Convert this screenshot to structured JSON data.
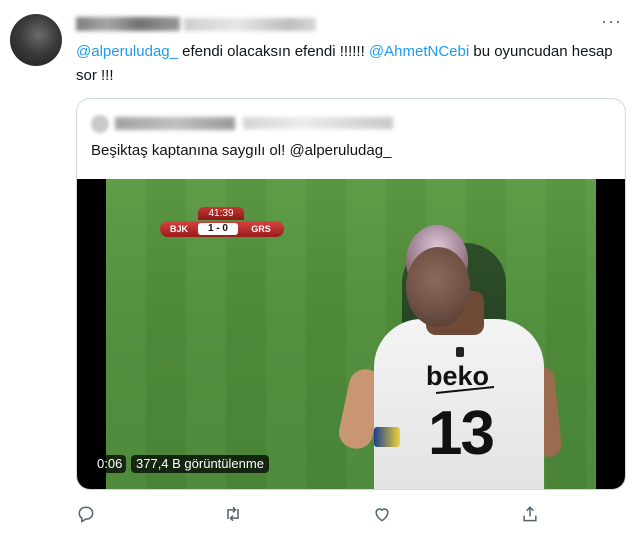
{
  "tweet": {
    "mention_1": "@alperuludag_",
    "text_1": " efendi olacaksın efendi !!!!!! ",
    "mention_2": "@AhmetNCebi",
    "text_2": " bu oyuncudan hesap sor !!!"
  },
  "quoted_tweet": {
    "text": "Beşiktaş kaptanına saygılı ol! @alperuludag_"
  },
  "video": {
    "time": "0:06",
    "views": "377,4 B görüntülenme",
    "scorebug": {
      "clock": "41:39",
      "home": "BJK",
      "score": "1 - 0",
      "away": "GRS"
    },
    "overlay_text": {
      "sponsor": "beko",
      "kit_number": "13"
    }
  },
  "actions": {
    "icons": [
      "reply-icon",
      "retweet-icon",
      "like-icon",
      "share-icon"
    ]
  },
  "colors": {
    "link": "#1d9bf0",
    "text": "#0f1419",
    "muted": "#536471",
    "border": "#cfd9de"
  }
}
